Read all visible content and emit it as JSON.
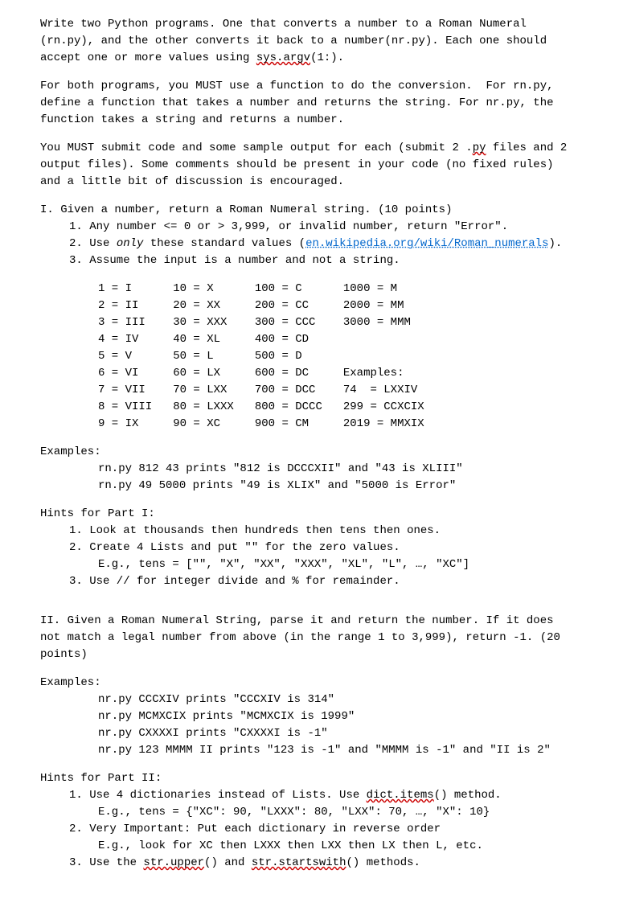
{
  "intro": {
    "p1a": "Write two Python programs. One that converts a number to a Roman Numeral (rn.py), and the other converts it back to a number(nr.py). Each one should accept one or more values using ",
    "p1_sysargv": "sys.argv",
    "p1b": "(1:).",
    "p2": "For both programs, you MUST use a function to do the conversion.  For rn.py, define a function that takes a number and returns the string. For nr.py, the function takes a string and returns a number.",
    "p3a": "You MUST submit code and some sample output for each (submit 2 .",
    "p3_py": "py",
    "p3b": " files and 2 output files). Some comments should be present in your code (no fixed rules) and a little bit of discussion is encouraged."
  },
  "part1": {
    "heading": "I. Given a number, return a Roman Numeral string. (10 points)",
    "item1": "1. Any number <= 0 or > 3,999, or invalid number, return \"Error\".",
    "item2a": "2. Use ",
    "item2_only": "only",
    "item2b": " these standard values (",
    "item2_link": "en.wikipedia.org/wiki/Roman_numerals",
    "item2c": ").",
    "item3": "3. Assume the input is a number and not a string.",
    "table": {
      "rows": [
        [
          "1 = I",
          "10 = X",
          "100 = C",
          "1000 = M"
        ],
        [
          "2 = II",
          "20 = XX",
          "200 = CC",
          "2000 = MM"
        ],
        [
          "3 = III",
          "30 = XXX",
          "300 = CCC",
          "3000 = MMM"
        ],
        [
          "4 = IV",
          "40 = XL",
          "400 = CD",
          ""
        ],
        [
          "5 = V",
          "50 = L",
          "500 = D",
          ""
        ],
        [
          "6 = VI",
          "60 = LX",
          "600 = DC",
          "Examples:"
        ],
        [
          "7 = VII",
          "70 = LXX",
          "700 = DCC",
          "74  = LXXIV"
        ],
        [
          "8 = VIII",
          "80 = LXXX",
          "800 = DCCC",
          "299 = CCXCIX"
        ],
        [
          "9 = IX",
          "90 = XC",
          "900 = CM",
          "2019 = MMXIX"
        ]
      ]
    },
    "examples_label": "Examples:",
    "ex1": "rn.py 812 43 prints \"812 is DCCCXII\" and \"43 is XLIII\"",
    "ex2": "rn.py 49 5000 prints \"49 is XLIX\" and \"5000 is Error\"",
    "hints_label": "Hints for Part I:",
    "hint1": "1. Look at thousands then hundreds then tens then ones.",
    "hint2": "2. Create 4 Lists and put \"\" for the zero values.",
    "hint2_eg": "E.g., tens = [\"\", \"X\", \"XX\", \"XXX\", \"XL\", \"L\", …, \"XC\"]",
    "hint3": "3. Use // for integer divide and % for remainder."
  },
  "part2": {
    "heading": "II. Given a Roman Numeral String, parse it and return the number. If it does not match a legal number from above (in the range 1 to 3,999), return -1. (20 points)",
    "examples_label": "Examples:",
    "ex1": "nr.py CCCXIV prints \"CCCXIV is 314\"",
    "ex2": "nr.py MCMXCIX prints \"MCMXCIX is 1999\"",
    "ex3": "nr.py CXXXXI prints \"CXXXXI is -1\"",
    "ex4": "nr.py 123 MMMM II prints \"123 is -1\" and \"MMMM is -1\" and \"II is 2\"",
    "hints_label": "Hints for Part II:",
    "hint1a": "1. Use 4 dictionaries instead of Lists. Use ",
    "hint1_dictitems": "dict.items",
    "hint1b": "() method.",
    "hint1_eg": "E.g., tens = {\"XC\": 90, \"LXXX\": 80, \"LXX\": 70, …, \"X\": 10}",
    "hint2": "2. Very Important: Put each dictionary in reverse order",
    "hint2_eg": "E.g., look for XC then LXXX then LXX then LX then L, etc.",
    "hint3a": "3. Use the ",
    "hint3_upper": "str.upper",
    "hint3b": "() and ",
    "hint3_startswith": "str.startswith",
    "hint3c": "() methods."
  }
}
